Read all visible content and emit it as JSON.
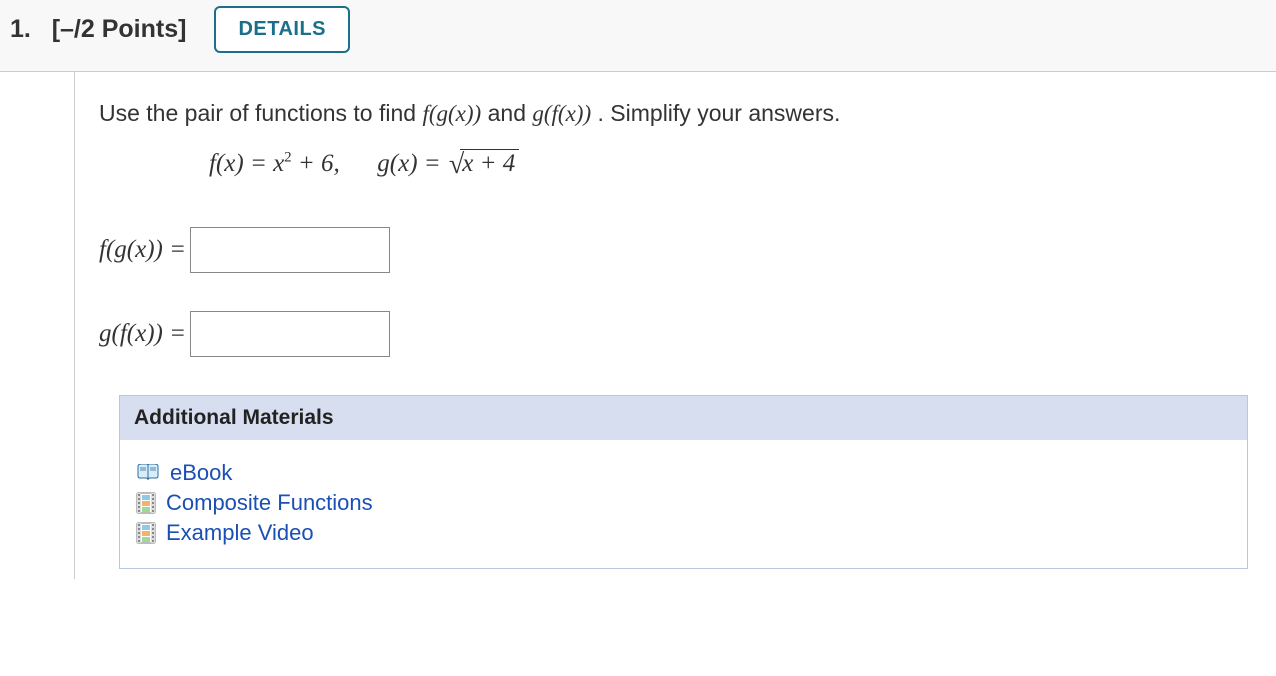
{
  "header": {
    "number": "1.",
    "points": "[–/2 Points]",
    "details_label": "DETAILS"
  },
  "question": {
    "prompt_prefix": "Use the pair of functions to find  ",
    "fg": "f(g(x))",
    "prompt_mid": "  and  ",
    "gf": "g(f(x))",
    "prompt_suffix": ".  Simplify your answers.",
    "func1_lhs": "f(x) = x",
    "func1_exp": "2",
    "func1_rhs": " + 6,",
    "func2_lhs": "g(x) = ",
    "func2_radicand": "x + 4",
    "answer1_label": "f(g(x)) = ",
    "answer2_label": "g(f(x)) = "
  },
  "materials": {
    "header": "Additional Materials",
    "links": [
      {
        "icon": "ebook",
        "label": "eBook"
      },
      {
        "icon": "film",
        "label": "Composite Functions"
      },
      {
        "icon": "film",
        "label": "Example Video"
      }
    ]
  }
}
